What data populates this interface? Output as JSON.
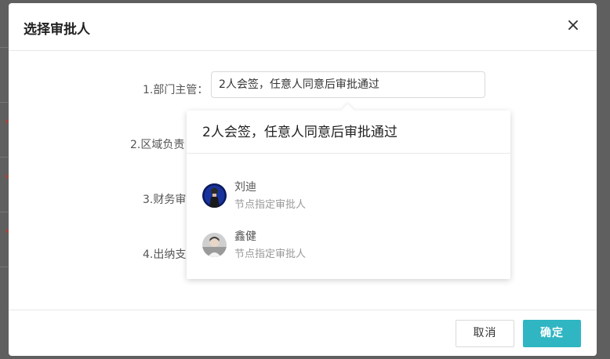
{
  "dialog": {
    "title": "选择审批人",
    "close_icon": "×"
  },
  "rows": [
    {
      "label": "1.部门主管：",
      "value": "2人会签，任意人同意后审批通过"
    },
    {
      "label": "2.区域负责"
    },
    {
      "label": "3.财务审"
    },
    {
      "label": "4.出纳支"
    }
  ],
  "dropdown": {
    "header": "2人会签，任意人同意后审批通过",
    "people": [
      {
        "name": "刘迪",
        "subtitle": "节点指定审批人",
        "avatar": "avatar-dark-photo"
      },
      {
        "name": "鑫健",
        "subtitle": "节点指定审批人",
        "avatar": "avatar-light-photo"
      }
    ]
  },
  "footer": {
    "cancel_label": "取消",
    "confirm_label": "确定"
  },
  "colors": {
    "accent": "#30b5c3",
    "overlay": "#5f5f5f"
  }
}
